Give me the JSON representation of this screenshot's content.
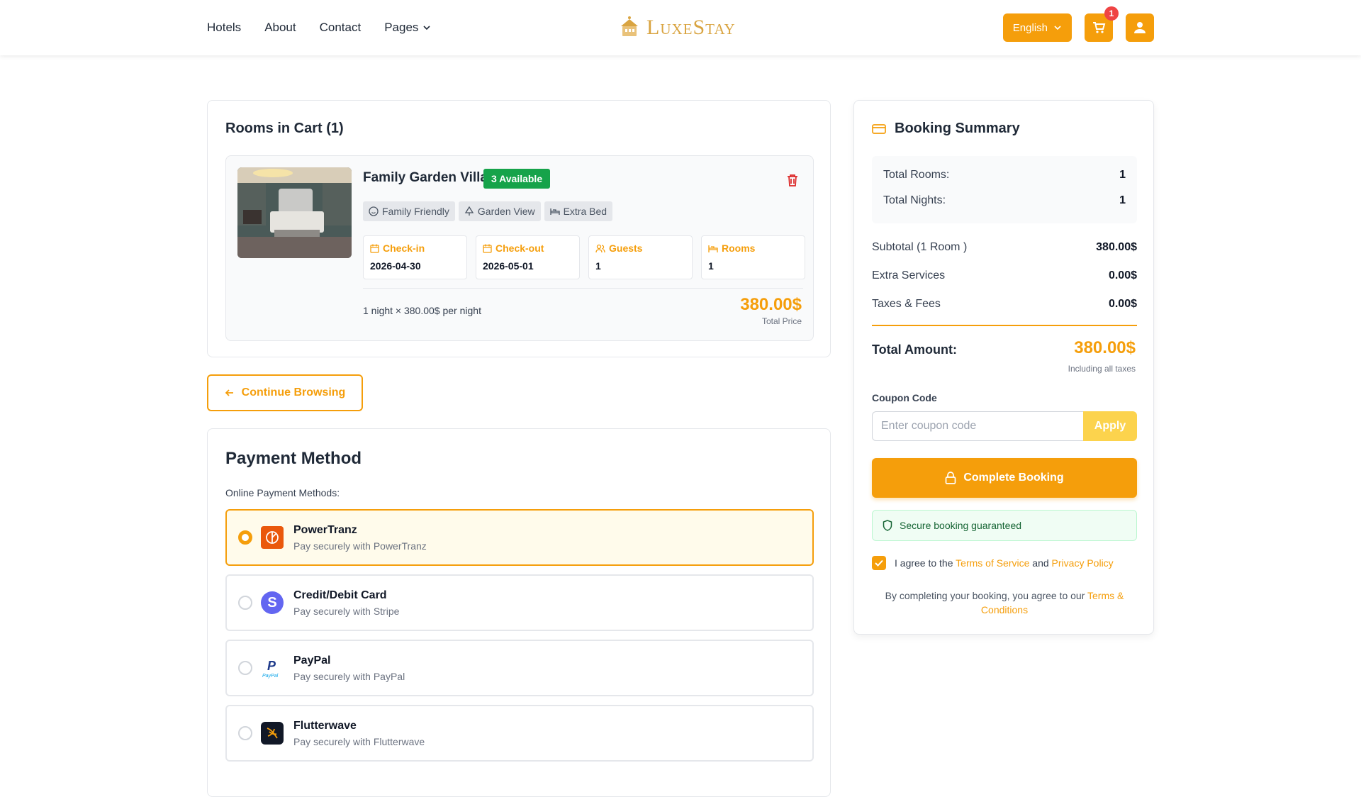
{
  "nav": {
    "items": [
      "Hotels",
      "About",
      "Contact",
      "Pages"
    ],
    "brand": "LuxeStay",
    "language": "English",
    "cart_count": "1"
  },
  "cart": {
    "title": "Rooms in Cart (1)",
    "room": {
      "name": "Family Garden Villa",
      "availability": "3 Available",
      "tags": [
        "Family Friendly",
        "Garden View",
        "Extra Bed"
      ],
      "fields": [
        {
          "label": "Check-in",
          "value": "2026-04-30"
        },
        {
          "label": "Check-out",
          "value": "2026-05-01"
        },
        {
          "label": "Guests",
          "value": "1"
        },
        {
          "label": "Rooms",
          "value": "1"
        }
      ],
      "night_line": "1 night × 380.00$ per night",
      "price": "380.00$",
      "price_label": "Total Price"
    },
    "continue_label": "Continue Browsing"
  },
  "payment": {
    "title": "Payment Method",
    "subtitle": "Online Payment Methods:",
    "options": [
      {
        "name": "PowerTranz",
        "desc": "Pay securely with PowerTranz",
        "selected": true
      },
      {
        "name": "Credit/Debit Card",
        "desc": "Pay securely with Stripe",
        "selected": false
      },
      {
        "name": "PayPal",
        "desc": "Pay securely with PayPal",
        "selected": false
      },
      {
        "name": "Flutterwave",
        "desc": "Pay securely with Flutterwave",
        "selected": false
      }
    ]
  },
  "summary": {
    "title": "Booking Summary",
    "total_rooms_label": "Total Rooms:",
    "total_rooms": "1",
    "total_nights_label": "Total Nights:",
    "total_nights": "1",
    "subtotal_label": "Subtotal (1 Room )",
    "subtotal": "380.00$",
    "extra_label": "Extra Services",
    "extra": "0.00$",
    "taxes_label": "Taxes & Fees",
    "taxes": "0.00$",
    "total_label": "Total Amount:",
    "total": "380.00$",
    "total_sub": "Including all taxes",
    "coupon_label": "Coupon Code",
    "coupon_placeholder": "Enter coupon code",
    "apply_label": "Apply",
    "complete_label": "Complete Booking",
    "secure_text": "Secure booking guaranteed",
    "agree_prefix": "I agree to the",
    "terms_link": "Terms of Service",
    "agree_and": "and",
    "privacy_link": "Privacy Policy",
    "fine_prefix": "By completing your booking, you agree to our",
    "fine_link": "Terms & Conditions"
  },
  "colors": {
    "accent": "#f59e0b",
    "success": "#16a34a",
    "danger": "#ef4444"
  }
}
